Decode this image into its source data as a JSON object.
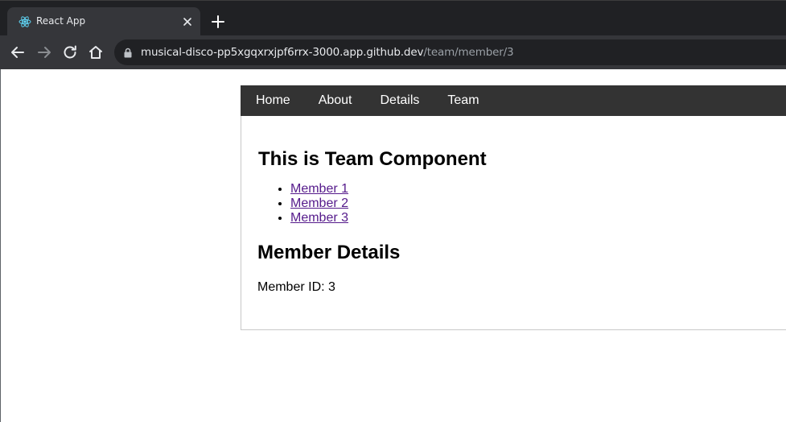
{
  "browser": {
    "tab": {
      "title": "React App",
      "favicon": "react-logo-icon"
    },
    "address_bar": {
      "host": "musical-disco-pp5xgqxrxjpf6rrx-3000.app.github.dev",
      "path": "/team/member/3"
    },
    "colors": {
      "tabstrip_bg": "#202124",
      "toolbar_bg": "#35363a",
      "react_blue": "#61dafb"
    }
  },
  "app": {
    "navbar": {
      "items": [
        {
          "label": "Home"
        },
        {
          "label": "About"
        },
        {
          "label": "Details"
        },
        {
          "label": "Team"
        }
      ],
      "bg": "#333333"
    },
    "team": {
      "heading": "This is Team Component",
      "members": [
        {
          "label": "Member 1"
        },
        {
          "label": "Member 2"
        },
        {
          "label": "Member 3"
        }
      ]
    },
    "details": {
      "heading": "Member Details",
      "member_id_text": "Member ID: 3"
    }
  }
}
